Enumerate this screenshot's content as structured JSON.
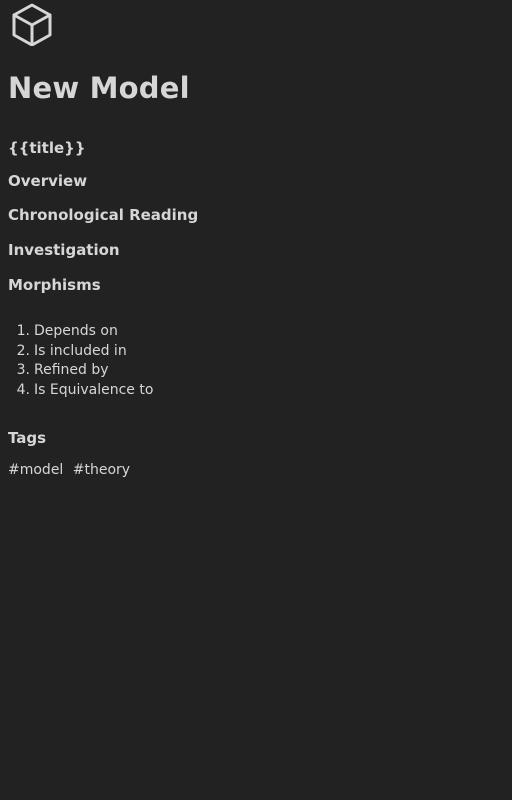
{
  "header": {
    "logo_icon": "cube-icon",
    "title": "New Model"
  },
  "sections": {
    "placeholder": "{{title}}",
    "overview": "Overview",
    "chronological": "Chronological Reading",
    "investigation": "Investigation",
    "morphisms": "Morphisms"
  },
  "morphisms": {
    "items": [
      {
        "num": "1.",
        "label": "Depends on"
      },
      {
        "num": "2.",
        "label": "Is included in"
      },
      {
        "num": "3.",
        "label": "Refined by"
      },
      {
        "num": "4.",
        "label": "Is Equivalence to"
      }
    ]
  },
  "tags": {
    "heading": "Tags",
    "items": [
      "#model",
      "#theory"
    ]
  },
  "colors": {
    "background": "#222222",
    "text": "#d6d6d6"
  }
}
